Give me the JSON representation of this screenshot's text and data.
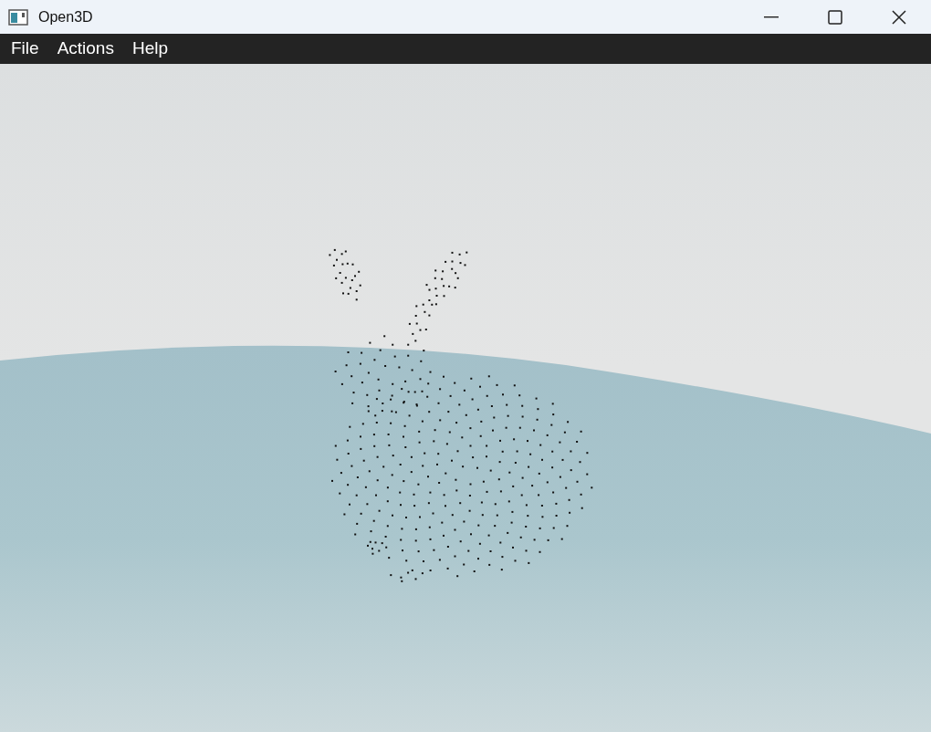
{
  "window": {
    "title": "Open3D"
  },
  "menu": [
    {
      "label": "File"
    },
    {
      "label": "Actions"
    },
    {
      "label": "Help"
    }
  ]
}
